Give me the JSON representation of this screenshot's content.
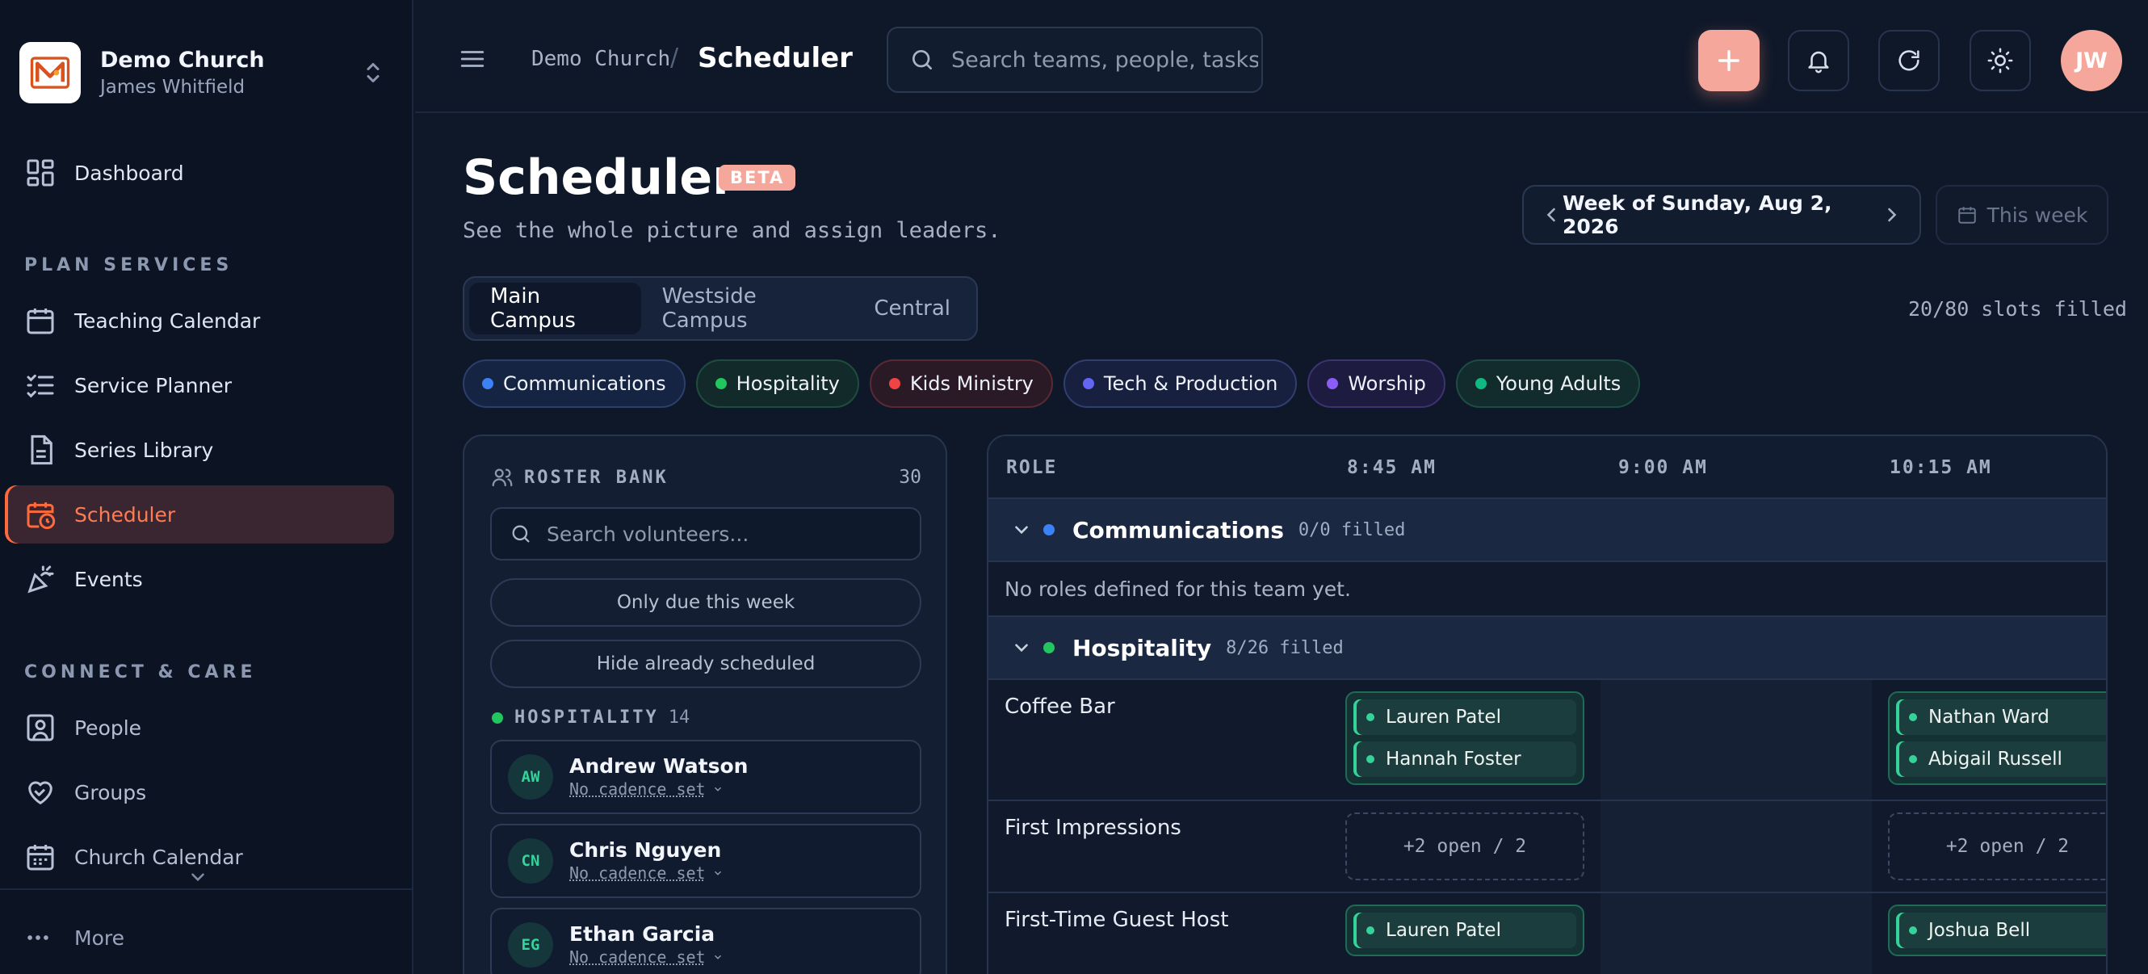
{
  "sidebar": {
    "org_name": "Demo Church",
    "user_name": "James Whitfield",
    "dashboard": "Dashboard",
    "section_plan": "PLAN SERVICES",
    "plan_items": [
      "Teaching Calendar",
      "Service Planner",
      "Series Library",
      "Scheduler",
      "Events"
    ],
    "section_connect": "CONNECT & CARE",
    "connect_items": [
      "People",
      "Groups",
      "Church Calendar"
    ],
    "more": "More",
    "active_item": "Scheduler"
  },
  "topbar": {
    "crumb_org": "Demo Church",
    "crumb_sep": "/",
    "crumb_page": "Scheduler",
    "search_placeholder": "Search teams, people, tasks.",
    "avatar_initials": "JW"
  },
  "page": {
    "title": "Scheduler",
    "badge": "BETA",
    "subtitle": "See the whole picture and assign leaders.",
    "week_label": "Week of Sunday, Aug 2, 2026",
    "this_week": "This week",
    "campuses": [
      "Main Campus",
      "Westside Campus",
      "Central"
    ],
    "active_campus": "Main Campus",
    "slots_filled": "20/80 slots filled"
  },
  "team_chips": [
    {
      "label": "Communications",
      "color": "#3b82f6"
    },
    {
      "label": "Hospitality",
      "color": "#22c55e"
    },
    {
      "label": "Kids Ministry",
      "color": "#ef4444"
    },
    {
      "label": "Tech & Production",
      "color": "#6366f1"
    },
    {
      "label": "Worship",
      "color": "#8b5cf6"
    },
    {
      "label": "Young Adults",
      "color": "#10b981"
    }
  ],
  "roster": {
    "title": "ROSTER BANK",
    "count": "30",
    "search_placeholder": "Search volunteers...",
    "filter_due": "Only due this week",
    "filter_hide": "Hide already scheduled",
    "group_name": "HOSPITALITY",
    "group_count": "14",
    "people": [
      {
        "initials": "AW",
        "name": "Andrew Watson",
        "cadence": "No cadence set"
      },
      {
        "initials": "CN",
        "name": "Chris Nguyen",
        "cadence": "No cadence set"
      },
      {
        "initials": "EG",
        "name": "Ethan Garcia",
        "cadence": "No cadence set"
      }
    ]
  },
  "grid": {
    "col_role": "ROLE",
    "times": [
      "8:45 AM",
      "9:00 AM",
      "10:15 AM"
    ],
    "teams": [
      {
        "name": "Communications",
        "filled": "0/0 filled",
        "color": "#3b82f6",
        "empty_text": "No roles defined for this team yet."
      },
      {
        "name": "Hospitality",
        "filled": "8/26 filled",
        "color": "#22c55e"
      }
    ],
    "roles": [
      {
        "name": "Coffee Bar",
        "slot_845": [
          "Lauren Patel",
          "Hannah Foster"
        ],
        "slot_1015": [
          "Nathan Ward",
          "Abigail Russell"
        ]
      },
      {
        "name": "First Impressions",
        "open_845": "+2 open / 2",
        "open_1015": "+2 open / 2"
      },
      {
        "name": "First-Time Guest Host",
        "slot_845": [
          "Lauren Patel"
        ],
        "slot_1015": [
          "Joshua Bell"
        ]
      }
    ]
  }
}
